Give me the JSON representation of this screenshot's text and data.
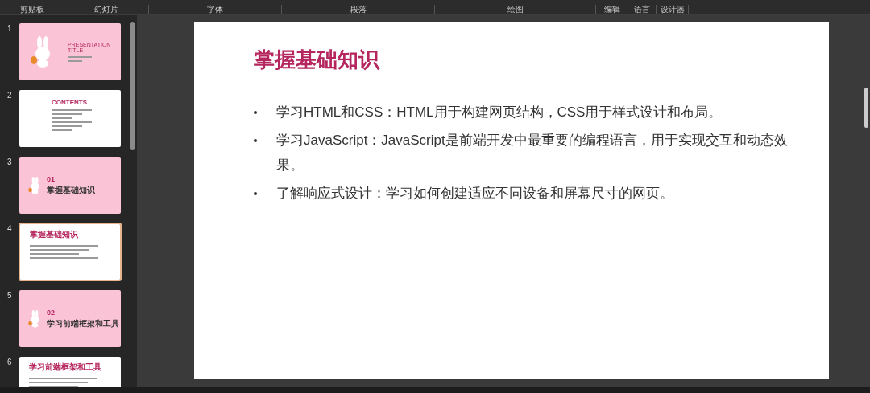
{
  "ribbon": {
    "groups": [
      {
        "label": "剪贴板"
      },
      {
        "label": "幻灯片"
      },
      {
        "label": "字体"
      },
      {
        "label": "段落"
      },
      {
        "label": "绘图"
      },
      {
        "label": "编辑"
      },
      {
        "label": "语言"
      },
      {
        "label": "设计器"
      }
    ]
  },
  "thumbnails": [
    {
      "number": "1",
      "kind": "title",
      "selected": false,
      "title": "PRESENTATION TITLE"
    },
    {
      "number": "2",
      "kind": "contents",
      "selected": false,
      "title": "CONTENTS"
    },
    {
      "number": "3",
      "kind": "section",
      "selected": false,
      "index": "01",
      "title": "掌握基础知识"
    },
    {
      "number": "4",
      "kind": "bullets",
      "selected": true,
      "title": "掌握基础知识"
    },
    {
      "number": "5",
      "kind": "section",
      "selected": false,
      "index": "02",
      "title": "学习前端框架和工具"
    },
    {
      "number": "6",
      "kind": "bullets",
      "selected": false,
      "title": "学习前端框架和工具"
    }
  ],
  "slide": {
    "title": "掌握基础知识",
    "bullets": [
      "学习HTML和CSS：HTML用于构建网页结构，CSS用于样式设计和布局。",
      "学习JavaScript：JavaScript是前端开发中最重要的编程语言，用于实现交互和动态效果。",
      "了解响应式设计：学习如何创建适应不同设备和屏幕尺寸的网页。"
    ]
  }
}
